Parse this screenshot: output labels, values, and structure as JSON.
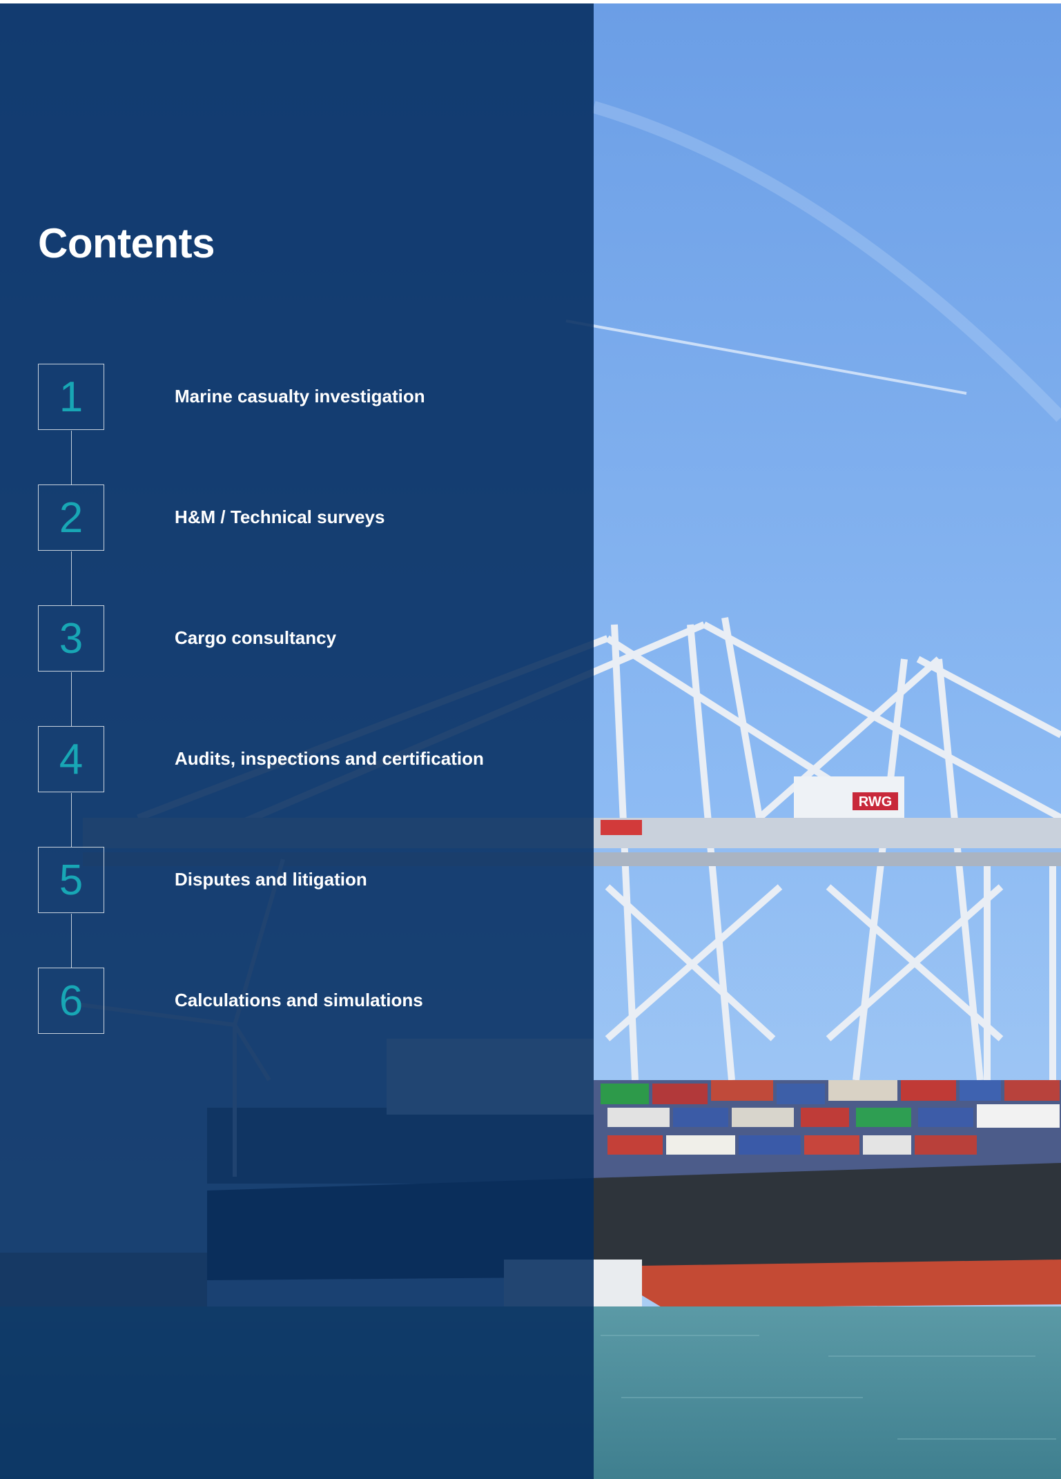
{
  "page": {
    "title": "Contents"
  },
  "toc": {
    "items": [
      {
        "number": "1",
        "label": "Marine casualty investigation"
      },
      {
        "number": "2",
        "label": "H&M / Technical surveys"
      },
      {
        "number": "3",
        "label": "Cargo consultancy"
      },
      {
        "number": "4",
        "label": "Audits, inspections and certification"
      },
      {
        "number": "5",
        "label": "Disputes and litigation"
      },
      {
        "number": "6",
        "label": "Calculations and simulations"
      }
    ]
  },
  "image": {
    "crane_logo": "RWG"
  },
  "colors": {
    "overlay": "#062e60",
    "accent_number": "#18a7b5",
    "sky": "#7fb0f0",
    "water": "#4f8c9c"
  }
}
